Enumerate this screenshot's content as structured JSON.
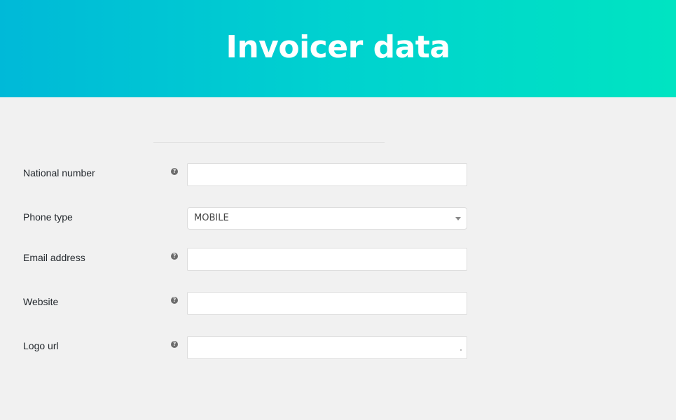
{
  "header": {
    "title": "Invoicer data"
  },
  "fields": {
    "national_number": {
      "label": "National number",
      "value": "",
      "placeholder": ""
    },
    "phone_type": {
      "label": "Phone type",
      "selected": "MOBILE"
    },
    "email": {
      "label": "Email address",
      "value": "",
      "placeholder": ""
    },
    "website": {
      "label": "Website",
      "value": "",
      "placeholder": ""
    },
    "logo_url": {
      "label": "Logo url",
      "value": "",
      "placeholder": ""
    }
  },
  "icons": {
    "help": "?"
  },
  "colors": {
    "header_start": "#00b9d8",
    "header_end": "#00e4c2",
    "background": "#f1f1f1"
  }
}
